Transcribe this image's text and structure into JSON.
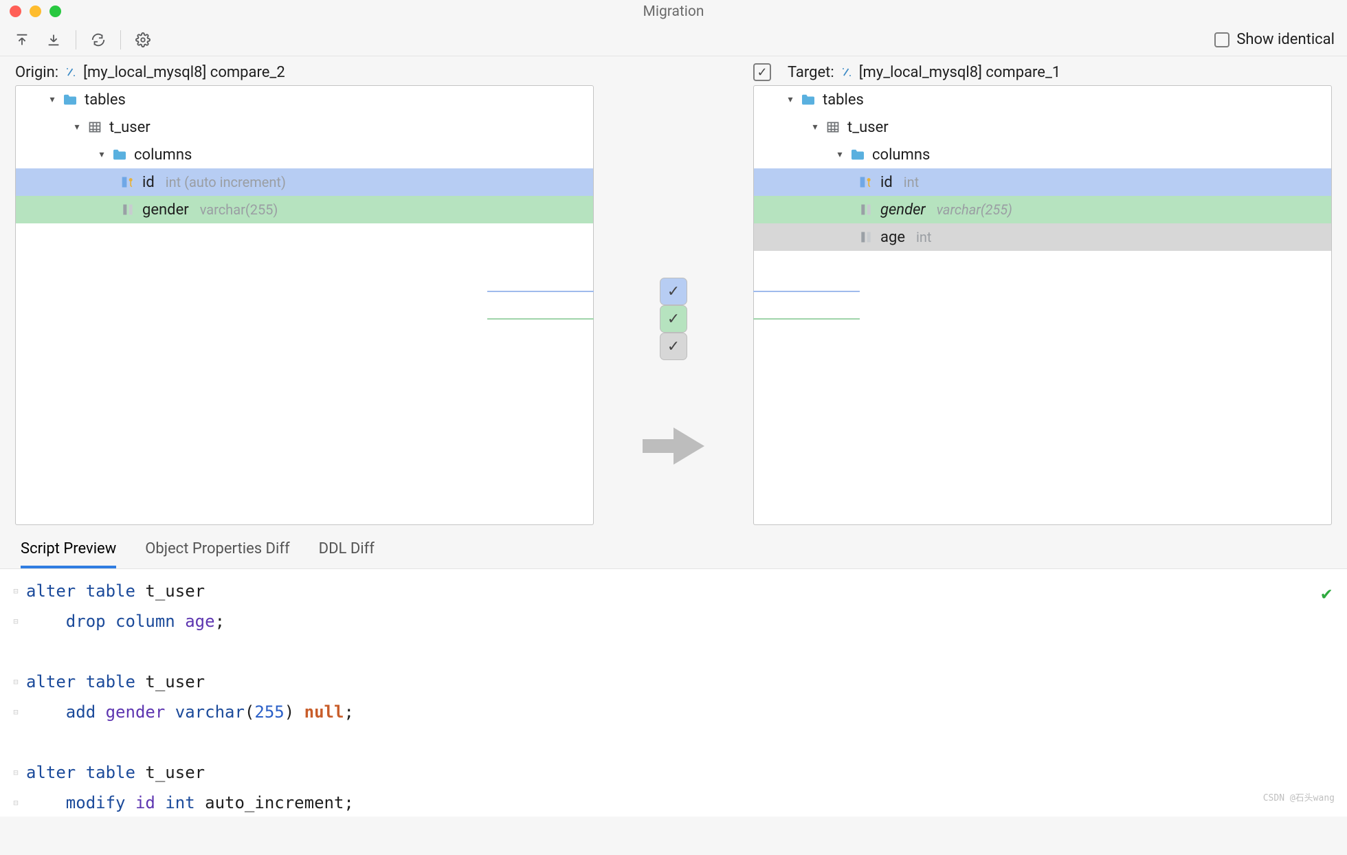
{
  "window": {
    "title": "Migration"
  },
  "toolbar": {
    "show_identical_label": "Show identical",
    "show_identical_checked": false
  },
  "origin": {
    "label": "Origin:",
    "datasource": "[my_local_mysql8] compare_2",
    "tree": {
      "tables_label": "tables",
      "table_name": "t_user",
      "columns_label": "columns",
      "columns": [
        {
          "name": "id",
          "type": "int (auto increment)",
          "kind": "changed"
        },
        {
          "name": "gender",
          "type": "varchar(255)",
          "kind": "added"
        }
      ]
    }
  },
  "target": {
    "label": "Target:",
    "datasource": "[my_local_mysql8] compare_1",
    "checked": true,
    "tree": {
      "tables_label": "tables",
      "table_name": "t_user",
      "columns_label": "columns",
      "columns": [
        {
          "name": "id",
          "type": "int",
          "kind": "changed"
        },
        {
          "name": "gender",
          "type": "varchar(255)",
          "kind": "added",
          "italic": true
        },
        {
          "name": "age",
          "type": "int",
          "kind": "removed"
        }
      ]
    }
  },
  "gap": {
    "rows": [
      {
        "checked": true,
        "color": "blue"
      },
      {
        "checked": true,
        "color": "green"
      },
      {
        "checked": true,
        "color": "grey"
      }
    ]
  },
  "tabs": {
    "items": [
      "Script Preview",
      "Object Properties Diff",
      "DDL Diff"
    ],
    "active": 0
  },
  "script": {
    "lines": [
      [
        {
          "t": "alter",
          "c": "kw"
        },
        {
          "t": " "
        },
        {
          "t": "table",
          "c": "kw"
        },
        {
          "t": " t_user"
        }
      ],
      [
        {
          "t": "    "
        },
        {
          "t": "drop column",
          "c": "kw"
        },
        {
          "t": " "
        },
        {
          "t": "age",
          "c": "pr"
        },
        {
          "t": ";"
        }
      ],
      [],
      [
        {
          "t": "alter",
          "c": "kw"
        },
        {
          "t": " "
        },
        {
          "t": "table",
          "c": "kw"
        },
        {
          "t": " t_user"
        }
      ],
      [
        {
          "t": "    "
        },
        {
          "t": "add",
          "c": "kw"
        },
        {
          "t": " "
        },
        {
          "t": "gender",
          "c": "pr"
        },
        {
          "t": " "
        },
        {
          "t": "varchar",
          "c": "kw"
        },
        {
          "t": "("
        },
        {
          "t": "255",
          "c": "nm"
        },
        {
          "t": ") "
        },
        {
          "t": "null",
          "c": "nl"
        },
        {
          "t": ";"
        }
      ],
      [],
      [
        {
          "t": "alter",
          "c": "kw"
        },
        {
          "t": " "
        },
        {
          "t": "table",
          "c": "kw"
        },
        {
          "t": " t_user"
        }
      ],
      [
        {
          "t": "    "
        },
        {
          "t": "modify",
          "c": "kw"
        },
        {
          "t": " "
        },
        {
          "t": "id",
          "c": "pr"
        },
        {
          "t": " "
        },
        {
          "t": "int",
          "c": "kw"
        },
        {
          "t": " auto_increment;"
        }
      ]
    ]
  },
  "watermark": "CSDN @石头wang"
}
